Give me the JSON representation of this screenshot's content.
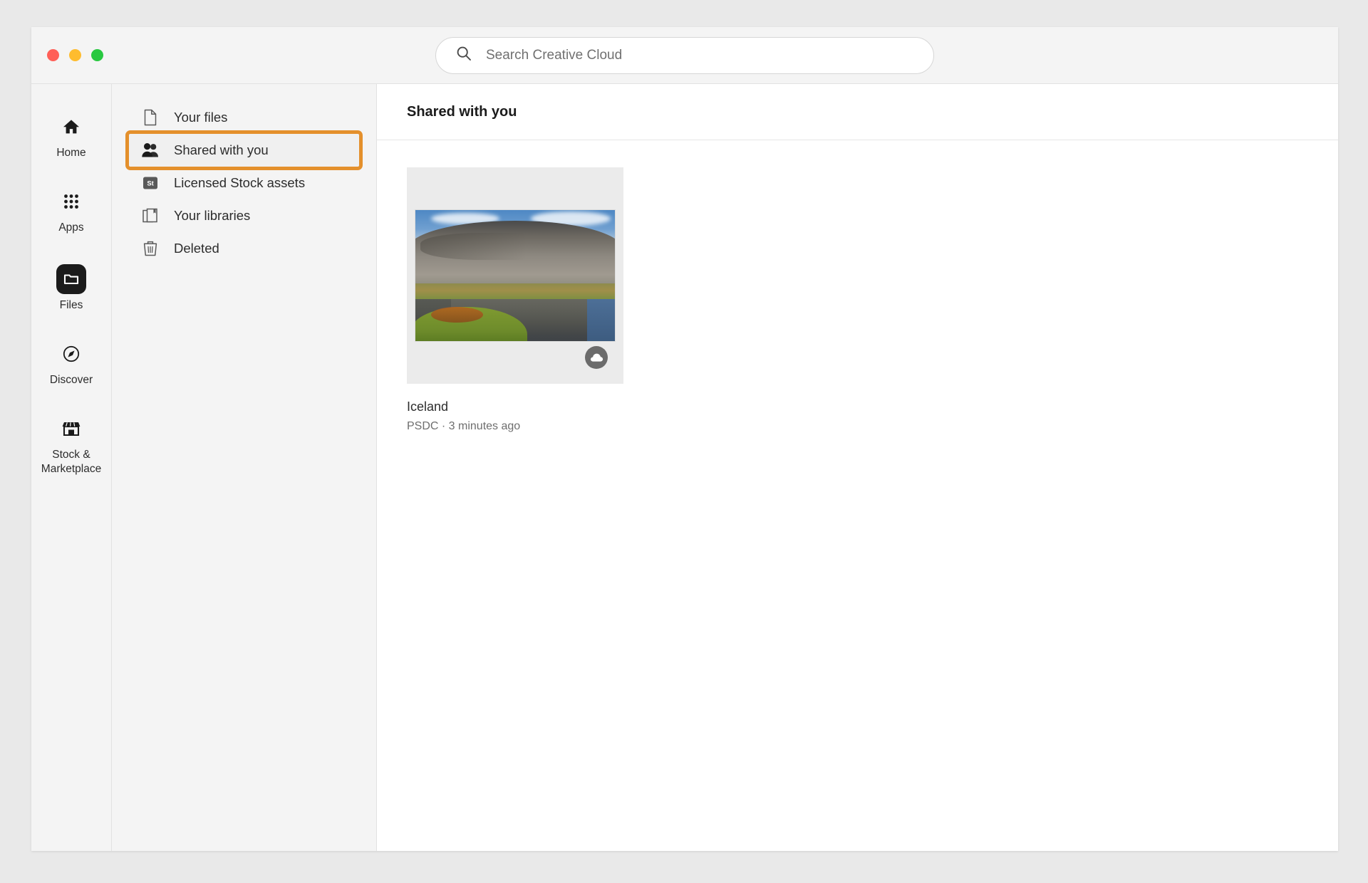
{
  "window": {
    "traffic_lights": [
      {
        "name": "close",
        "color": "#ff5f57"
      },
      {
        "name": "minimize",
        "color": "#febc2e"
      },
      {
        "name": "maximize",
        "color": "#28c840"
      }
    ]
  },
  "search": {
    "placeholder": "Search Creative Cloud",
    "value": "",
    "icon": "search-icon"
  },
  "rail": {
    "items": [
      {
        "label": "Home",
        "icon": "home-icon",
        "active": false
      },
      {
        "label": "Apps",
        "icon": "grid-apps-icon",
        "active": false
      },
      {
        "label": "Files",
        "icon": "folder-icon",
        "active": true
      },
      {
        "label": "Discover",
        "icon": "compass-icon",
        "active": false
      },
      {
        "label": "Stock &\nMarketplace",
        "icon": "storefront-icon",
        "active": false
      }
    ]
  },
  "nav": {
    "items": [
      {
        "label": "Your files",
        "icon": "document-icon",
        "selected": false
      },
      {
        "label": "Shared with you",
        "icon": "people-icon",
        "selected": true
      },
      {
        "label": "Licensed Stock assets",
        "icon": "stock-st-icon",
        "selected": false
      },
      {
        "label": "Your libraries",
        "icon": "library-books-icon",
        "selected": false
      },
      {
        "label": "Deleted",
        "icon": "trash-icon",
        "selected": false
      }
    ],
    "highlight_color": "#e4902c"
  },
  "main": {
    "title": "Shared with you",
    "cards": [
      {
        "name": "Iceland",
        "meta": "PSDC · 3 minutes ago",
        "badge": "cloud-icon",
        "thumbnail_alt": "Iceland landscape photo with mountain ridge reflected in a lake"
      }
    ]
  }
}
